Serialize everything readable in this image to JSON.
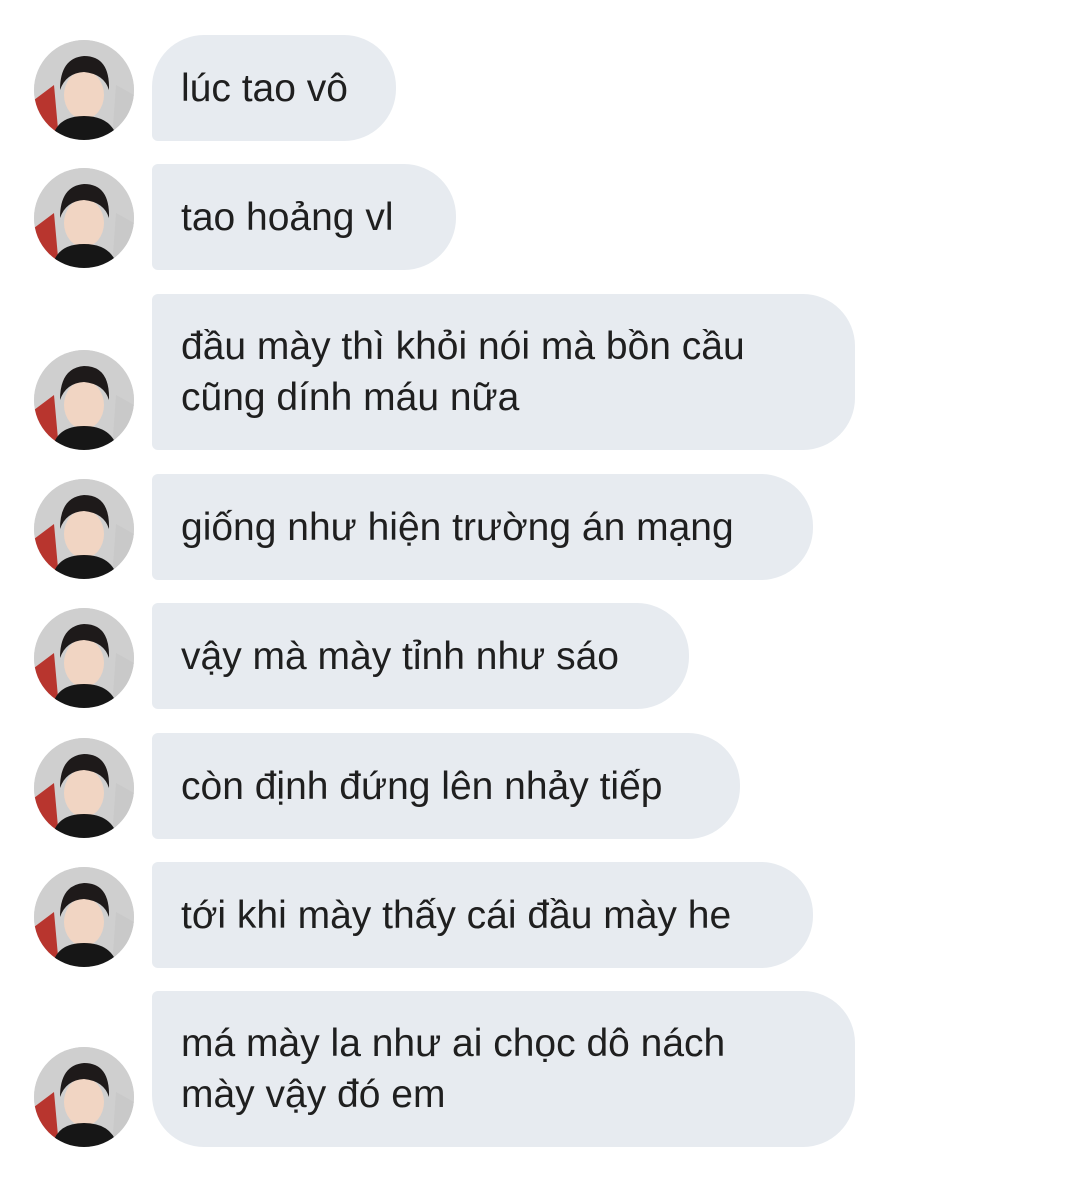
{
  "conversation": {
    "messages": [
      {
        "text": "lúc tao vô",
        "avatar": "avatar-photo"
      },
      {
        "text": "tao hoảng vl",
        "avatar": "avatar-photo"
      },
      {
        "text": "đầu mày thì khỏi nói mà bồn cầu\ncũng dính máu nữa",
        "avatar": "avatar-photo"
      },
      {
        "text": "giống như hiện trường án mạng",
        "avatar": "avatar-photo"
      },
      {
        "text": "vậy mà mày tỉnh như sáo",
        "avatar": "avatar-photo"
      },
      {
        "text": "còn định đứng lên nhảy tiếp",
        "avatar": "avatar-photo"
      },
      {
        "text": "tới khi mày thấy cái đầu mày he",
        "avatar": "avatar-photo"
      },
      {
        "text": "má mày la như ai chọc dô nách\nmày vậy đó em",
        "avatar": "avatar-photo"
      }
    ]
  },
  "colors": {
    "bubble_background": "#e7ebf0",
    "text": "#1f1f1f",
    "background": "#ffffff"
  }
}
